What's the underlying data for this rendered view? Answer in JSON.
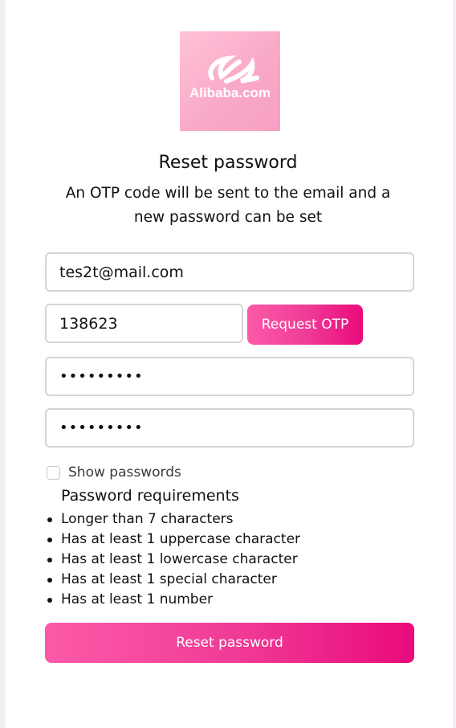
{
  "logo": {
    "text": "Alibaba.com"
  },
  "header": {
    "title": "Reset password",
    "subtitle": "An OTP code will be sent to the email and a new password can be set"
  },
  "form": {
    "email_value": "tes2t@mail.com",
    "otp_value": "138623",
    "request_otp_label": "Request OTP",
    "password_value": "•••••••••",
    "confirm_password_value": "•••••••••",
    "show_passwords_label": "Show passwords",
    "show_passwords_checked": false,
    "reset_button_label": "Reset password"
  },
  "requirements": {
    "title": "Password requirements",
    "items": [
      "Longer than 7 characters",
      "Has at least 1 uppercase character",
      "Has at least 1 lowercase character",
      "Has at least 1 special character",
      "Has at least 1 number"
    ]
  },
  "colors": {
    "accent_start": "#fc5aa8",
    "accent_end": "#ea0a7c",
    "logo_bg": "#f9a9c8"
  }
}
